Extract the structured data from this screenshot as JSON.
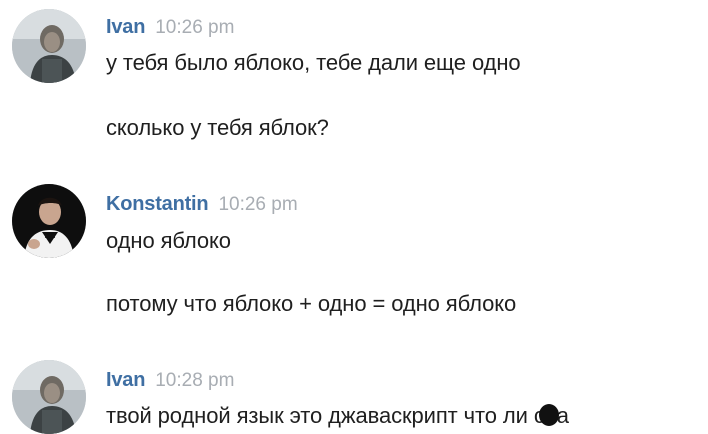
{
  "messages": [
    {
      "author": "Ivan",
      "time": "10:26 pm",
      "lines": [
        "у тебя было яблоко, тебе дали еще одно",
        "сколько у тебя яблок?"
      ],
      "avatar_icon": "user-avatar-ivan"
    },
    {
      "author": "Konstantin",
      "time": "10:26 pm",
      "lines": [
        "одно яблоко",
        "потому что яблоко + одно = одно яблоко"
      ],
      "avatar_icon": "user-avatar-konstantin"
    },
    {
      "author": "Ivan",
      "time": "10:28 pm",
      "lines": [
        "твой родной язык это джаваскрипт что ли с",
        "а"
      ],
      "avatar_icon": "user-avatar-ivan"
    }
  ],
  "colors": {
    "author": "#3f6fa3",
    "time": "#a8adb3",
    "text": "#1f1f1f",
    "background": "#ffffff"
  }
}
